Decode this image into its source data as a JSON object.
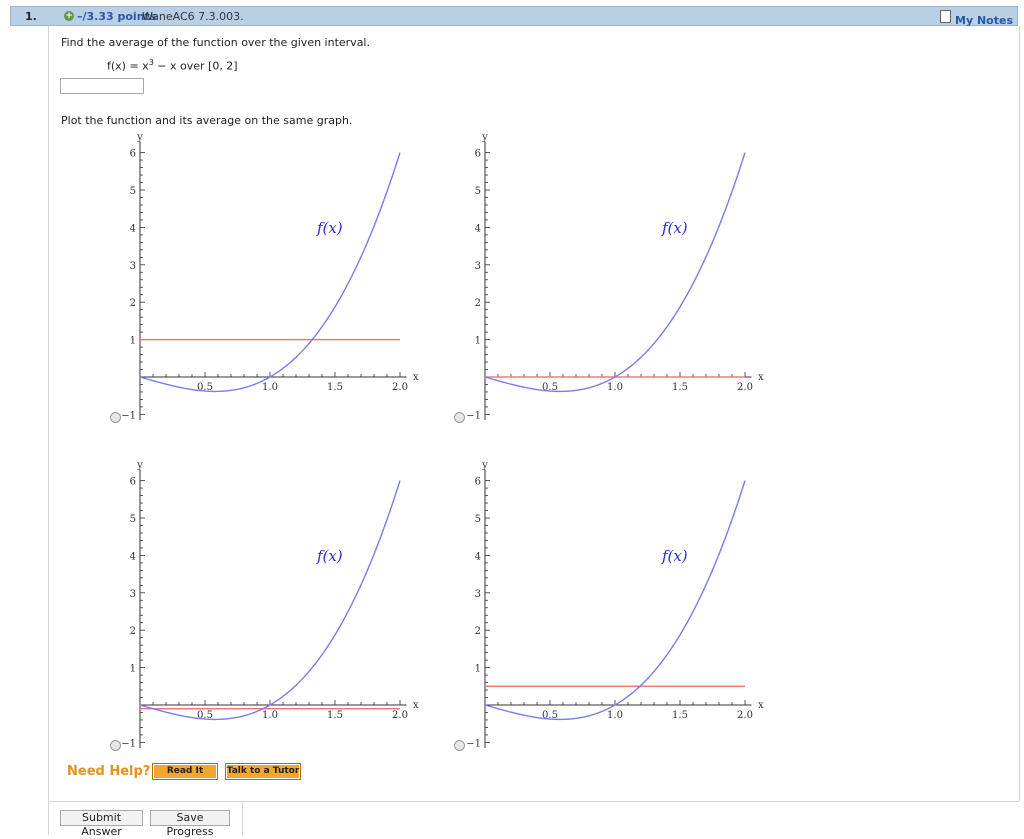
{
  "question": {
    "number": "1.",
    "points": "–/3.33 points",
    "code": "WaneAC6 7.3.003.",
    "my_notes": "My Notes",
    "prompt": "Find the average of the function over the given interval.",
    "function_prefix": "f(x) = x",
    "function_exponent": "3",
    "function_suffix": " − x over [0, 2]",
    "answer_value": "",
    "plot_prompt": "Plot the function and its average on the same graph."
  },
  "graphs": {
    "curve_label": "f(x)",
    "x_axis_label": "x",
    "y_axis_label": "y",
    "x_ticks": [
      "0.5",
      "1.0",
      "1.5",
      "2.0"
    ],
    "y_ticks": [
      "6",
      "5",
      "4",
      "3",
      "2",
      "1",
      "−1"
    ],
    "curve_color": "#7b7bf0",
    "average_color": "#f07a7a",
    "options": [
      {
        "name": "option-a",
        "average_value": 1
      },
      {
        "name": "option-b",
        "average_value": 0
      },
      {
        "name": "option-c",
        "average_value": -0.1
      },
      {
        "name": "option-d",
        "average_value": 0.5
      }
    ]
  },
  "chart_data": [
    {
      "type": "line",
      "xlabel": "x",
      "ylabel": "y",
      "xlim": [
        0,
        2
      ],
      "ylim": [
        -1,
        6
      ],
      "series": [
        {
          "name": "f(x)",
          "formula": "x^3 - x"
        },
        {
          "values_constant": 1
        }
      ]
    },
    {
      "type": "line",
      "xlabel": "x",
      "ylabel": "y",
      "xlim": [
        0,
        2
      ],
      "ylim": [
        -1,
        6
      ],
      "series": [
        {
          "name": "f(x)",
          "formula": "x^3 - x"
        },
        {
          "values_constant": 0
        }
      ]
    },
    {
      "type": "line",
      "xlabel": "x",
      "ylabel": "y",
      "xlim": [
        0,
        2
      ],
      "ylim": [
        -1,
        6
      ],
      "series": [
        {
          "name": "f(x)",
          "formula": "x^3 - x"
        },
        {
          "values_constant": -0.1
        }
      ]
    },
    {
      "type": "line",
      "xlabel": "x",
      "ylabel": "y",
      "xlim": [
        0,
        2
      ],
      "ylim": [
        -1,
        6
      ],
      "series": [
        {
          "name": "f(x)",
          "formula": "x^3 - x"
        },
        {
          "values_constant": 0.5
        }
      ]
    }
  ],
  "help": {
    "label": "Need Help?",
    "read_it": "Read It",
    "talk_to_tutor": "Talk to a Tutor"
  },
  "footer": {
    "submit": "Submit Answer",
    "save": "Save Progress"
  }
}
